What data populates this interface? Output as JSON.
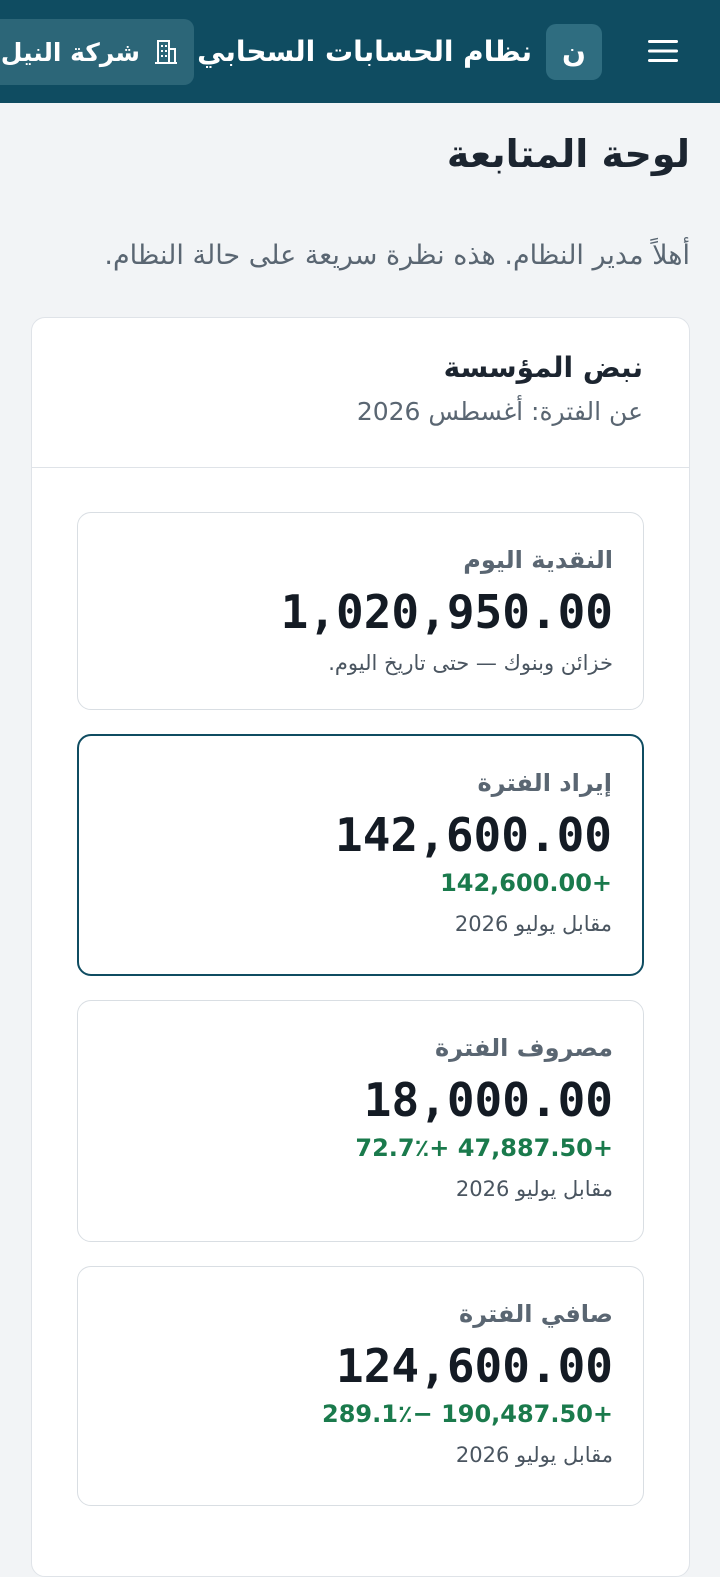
{
  "header": {
    "app_title": "نظام الحسابات السحابي",
    "avatar_letter": "ن",
    "company_name": "شركة النيل"
  },
  "page": {
    "title": "لوحة المتابعة",
    "welcome": "أهلاً مدير النظام. هذه نظرة سريعة على حالة النظام."
  },
  "panel": {
    "title": "نبض المؤسسة",
    "period": "عن الفترة: أغسطس 2026"
  },
  "kpis": [
    {
      "label": "النقدية اليوم",
      "value": "1,020,950.00",
      "note": "خزائن وبنوك — حتى تاريخ اليوم."
    },
    {
      "label": "إيراد الفترة",
      "value": "142,600.00",
      "delta": "+142,600.00",
      "note": "مقابل يوليو 2026"
    },
    {
      "label": "مصروف الفترة",
      "value": "18,000.00",
      "delta": "+47,887.50 +72.7٪",
      "note": "مقابل يوليو 2026"
    },
    {
      "label": "صافي الفترة",
      "value": "124,600.00",
      "delta": "+190,487.50 −289.1٪",
      "note": "مقابل يوليو 2026"
    }
  ],
  "colors": {
    "header_bg": "#0f4c61",
    "positive": "#1a7a4c",
    "active_border": "#0f4c61"
  },
  "icons": {
    "menu": "hamburger-menu-icon",
    "company": "building-icon"
  }
}
